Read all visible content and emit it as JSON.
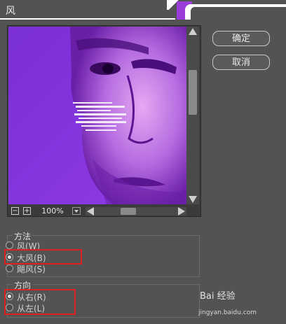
{
  "window": {
    "title": "风"
  },
  "buttons": {
    "ok_label": "确定",
    "cancel_label": "取消"
  },
  "zoom": {
    "value": "100%",
    "minus_label": "−",
    "plus_label": "+"
  },
  "method": {
    "title": "方法",
    "options": [
      {
        "label": "风(W)",
        "selected": false
      },
      {
        "label": "大风(B)",
        "selected": true
      },
      {
        "label": "飓风(S)",
        "selected": false
      }
    ]
  },
  "direction": {
    "title": "方向",
    "options": [
      {
        "label": "从右(R)",
        "selected": true
      },
      {
        "label": "从左(L)",
        "selected": false
      }
    ]
  },
  "watermark": {
    "text": "Bai 经验",
    "url": "jingyan.baidu.com"
  },
  "colors": {
    "background": "#535353",
    "preview_tint": "#8a2be2",
    "highlight": "#e02020"
  }
}
